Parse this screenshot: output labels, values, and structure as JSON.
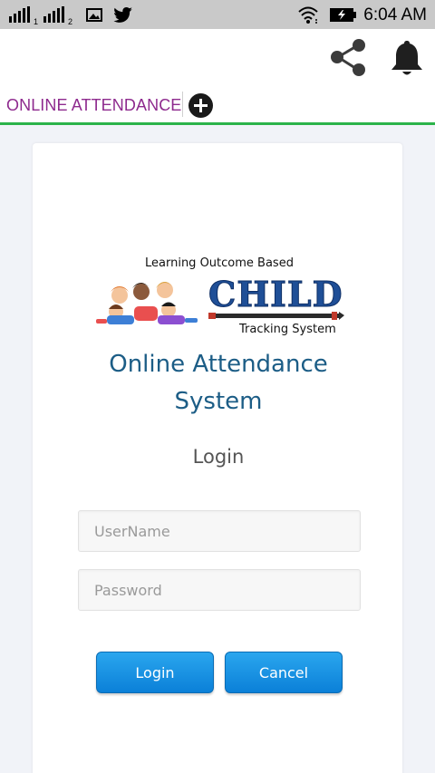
{
  "status_bar": {
    "time": "6:04 AM",
    "sim1_label": "1",
    "sim2_label": "2",
    "icons": [
      "signal-sim1-icon",
      "signal-sim2-icon",
      "image-notification-icon",
      "twitter-icon",
      "wifi-icon",
      "battery-charging-icon"
    ]
  },
  "app_bar": {
    "icons": [
      "share-icon",
      "bell-icon"
    ]
  },
  "tab": {
    "label": "ONLINE ATTENDANCE",
    "add_icon": "add-circle-icon",
    "accent_color": "#2cb34a",
    "label_color": "#8e2a8e"
  },
  "logo": {
    "tagline_top": "Learning Outcome Based",
    "word": "CHILD",
    "tagline_bottom": "Tracking System"
  },
  "card": {
    "title": "Online Attendance System",
    "login_heading": "Login",
    "username_placeholder": "UserName",
    "password_placeholder": "Password",
    "login_button": "Login",
    "cancel_button": "Cancel",
    "title_color": "#1c5d86",
    "button_color": "#1a93e3"
  }
}
